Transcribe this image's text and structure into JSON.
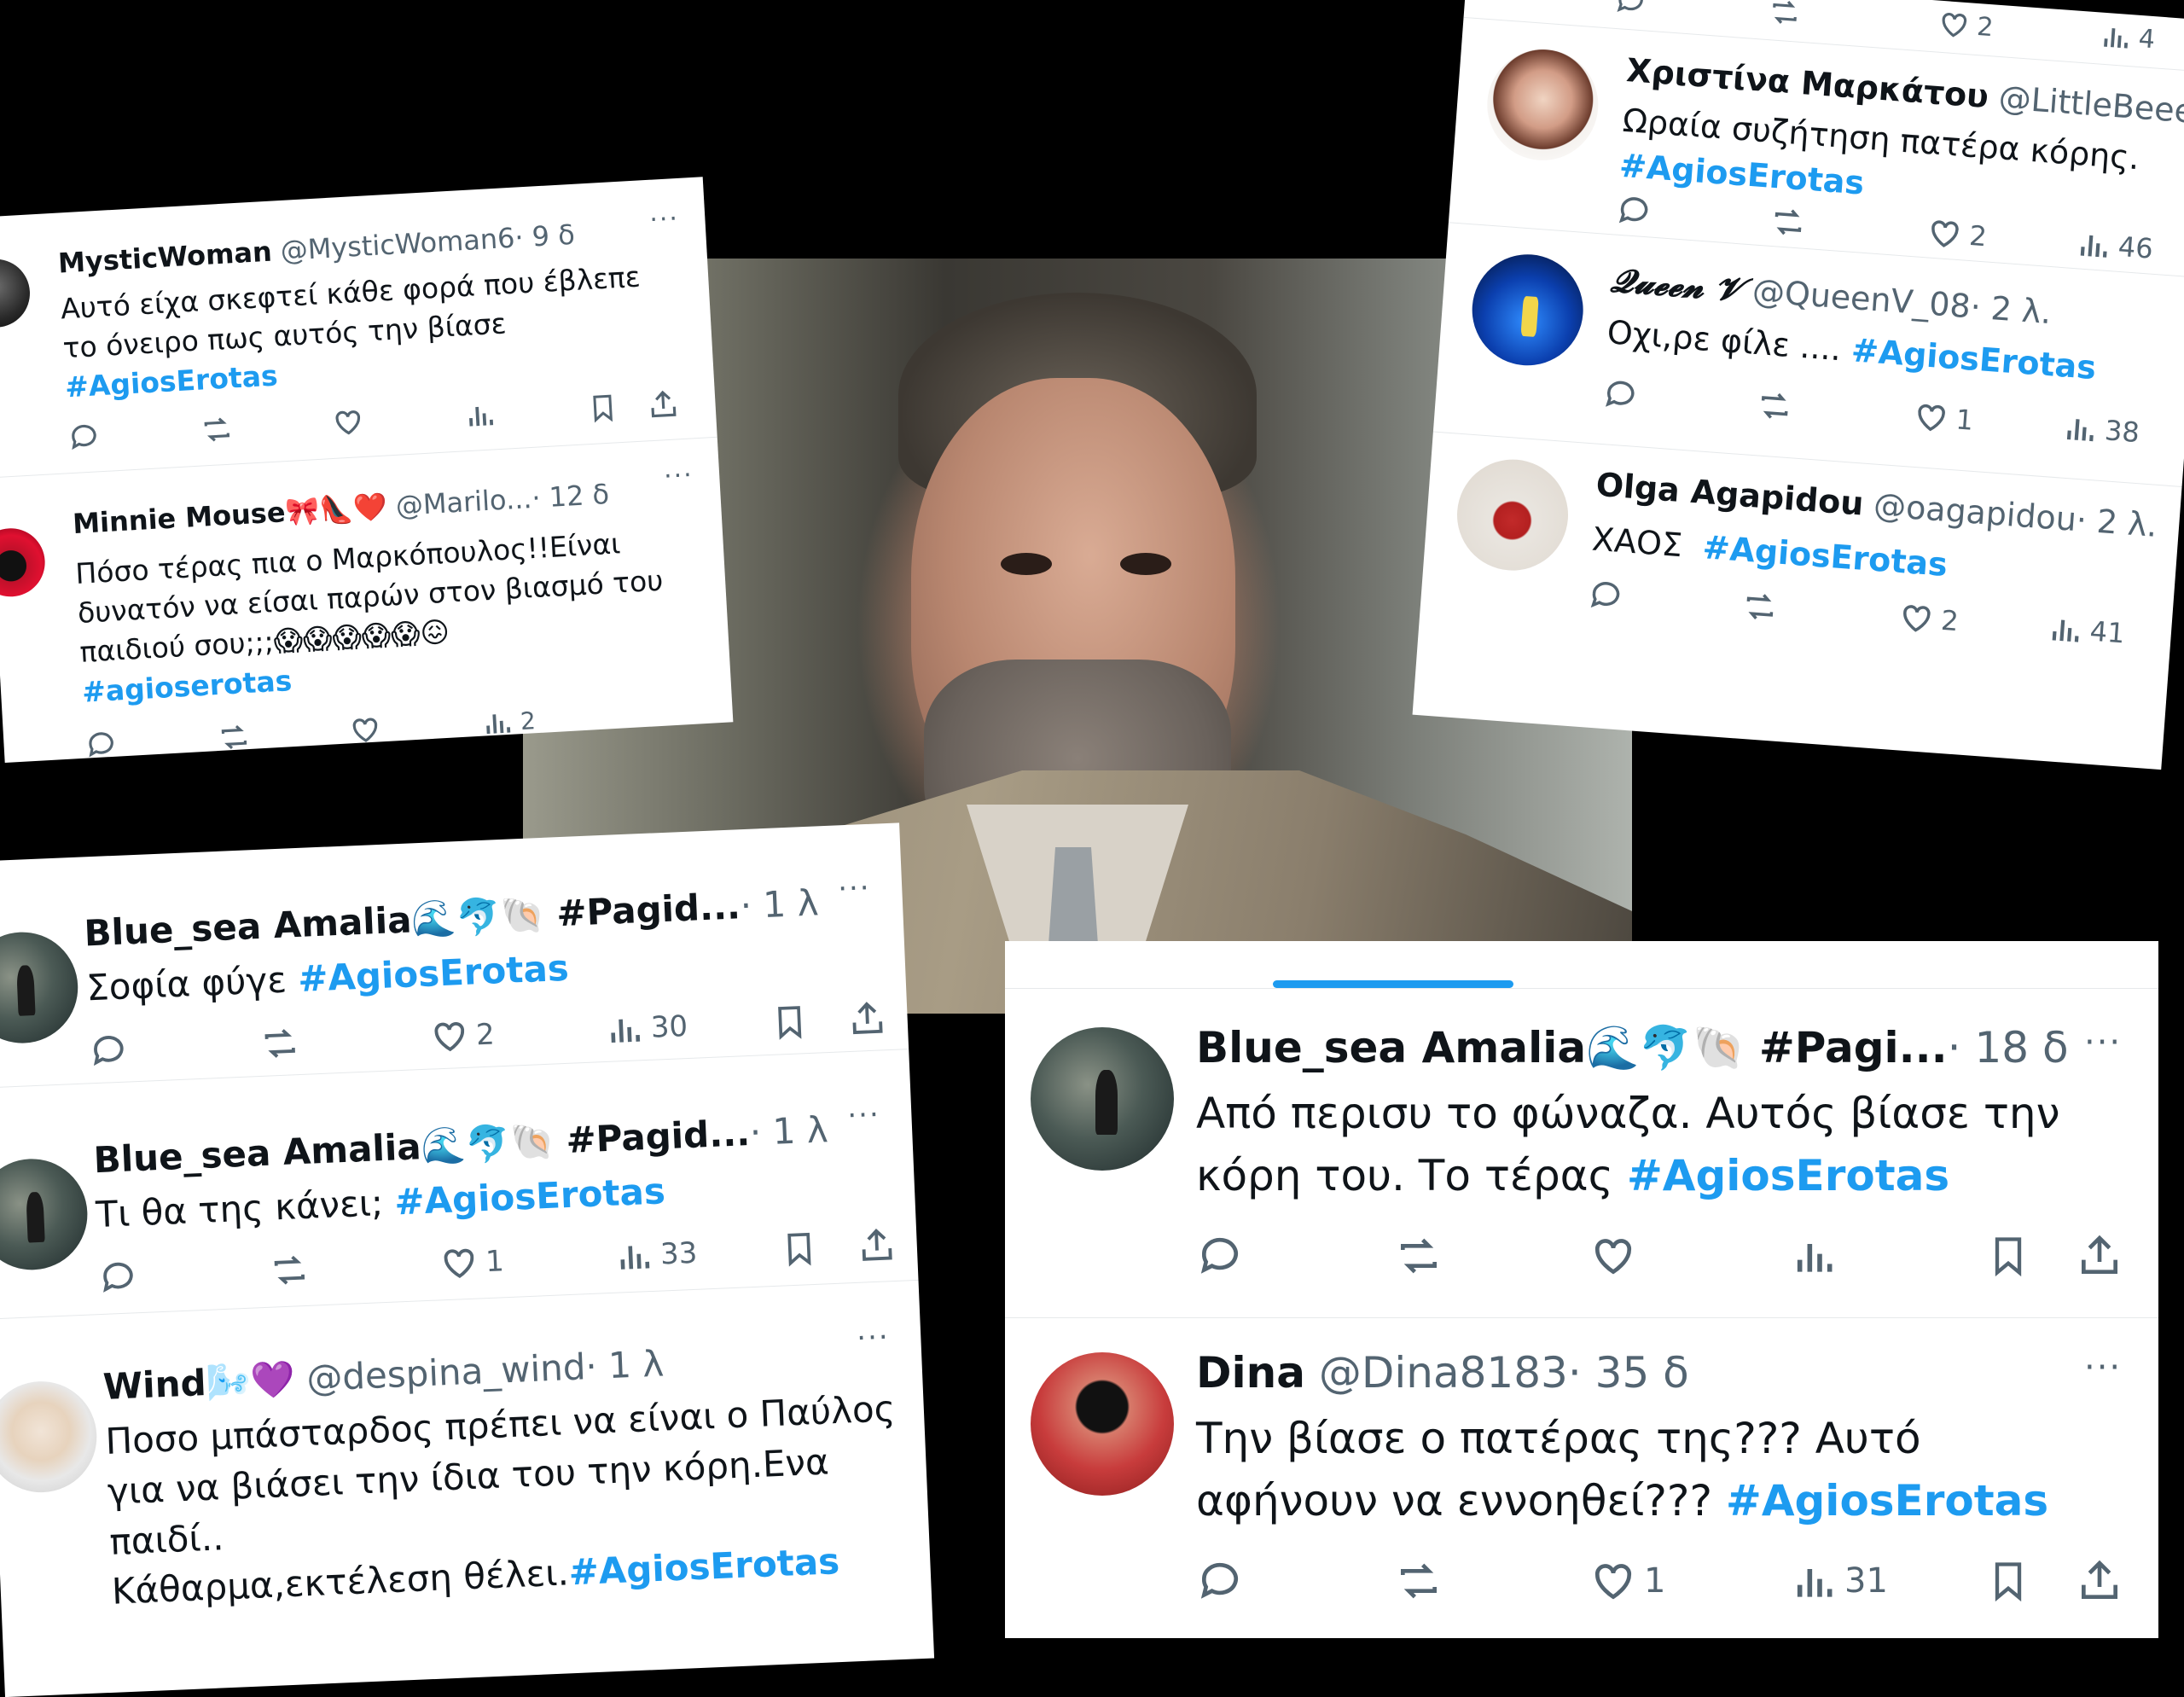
{
  "card1": {
    "tweets": [
      {
        "name": "MysticWoman",
        "handle": "@MysticWoman6",
        "time": "· 9 δ",
        "text": "Αυτό είχα σκεφτεί κάθε φορά που έβλεπε το όνειρο πως αυτός την βίασε",
        "tag": "#AgiosErotas",
        "likes": "",
        "views": ""
      },
      {
        "name": "Minnie Mouse🎀👠❤️",
        "handle": "@Marilo...",
        "time": "· 12 δ",
        "text": "Πόσο τέρας πια ο Μαρκόπουλος!!Είναι δυνατόν να είσαι παρών στον βιασμό του παιδιού σου;;;😱😱😱😱😱😖",
        "tag": "#agioserotas",
        "likes": "",
        "views": "2"
      }
    ]
  },
  "card2": {
    "top_likes": "2",
    "top_views": "4",
    "tweets": [
      {
        "name": "Χριστίνα Μαρκάτου",
        "handle": "@LittleBeee",
        "time": "",
        "text": "Ωραία συζήτηση πατέρα κόρης.",
        "tag": "#AgiosErotas",
        "likes": "2",
        "views": "46"
      },
      {
        "name": "𝓠𝓾𝓮𝓮𝓷 𝓥",
        "handle": "@QueenV_08",
        "time": "· 2 λ.",
        "text": "Οχι,ρε φίλε ....",
        "tag": "#AgiosErotas",
        "likes": "1",
        "views": "38"
      },
      {
        "name": "Olga Agapidou",
        "handle": "@oagapidou",
        "time": "· 2 λ.",
        "text": "ΧΑΟΣ",
        "tag": "#AgiosErotas",
        "likes": "2",
        "views": "41"
      }
    ]
  },
  "card3": {
    "tweets": [
      {
        "name": "Blue_sea Amalia🌊🐬🐚",
        "handle": "#Pagid...",
        "time": "· 1 λ",
        "text": "Σοφία φύγε",
        "tag": "#AgiosErotas",
        "likes": "2",
        "views": "30"
      },
      {
        "name": "Blue_sea Amalia🌊🐬🐚",
        "handle": "#Pagid...",
        "time": "· 1 λ",
        "text": "Τι θα της κάνει;",
        "tag": "#AgiosErotas",
        "likes": "1",
        "views": "33"
      },
      {
        "name": "Wind🌬️💜",
        "handle": "@despina_wind",
        "time": "· 1 λ",
        "text": "Ποσο μπάσταρδος πρέπει να είναι ο Παύλος για να βιάσει την ίδια του την κόρη.Ενα παιδί..",
        "text2": "Κάθαρμα,εκτέλεση θέλει.",
        "tag": "#AgiosErotas",
        "likes": "",
        "views": ""
      }
    ]
  },
  "card4": {
    "tweets": [
      {
        "name": "Blue_sea Amalia🌊🐬🐚",
        "handle": "#Pagi...",
        "time": "· 18 δ",
        "text": "Από περισυ το φώναζα. Αυτός βίασε την κόρη του. Το τέρας",
        "tag": "#AgiosErotas",
        "likes": "",
        "views": ""
      },
      {
        "name": "Dina",
        "handle": "@Dina8183",
        "time": "· 35 δ",
        "text": "Την βίασε ο πατέρας της??? Αυτό αφήνουν να εννοηθεί???",
        "tag": "#AgiosErotas",
        "likes": "1",
        "views": "31"
      }
    ]
  },
  "colors": {
    "hashtag": "#1d9bf0",
    "muted": "#536471",
    "text": "#0f1419"
  }
}
